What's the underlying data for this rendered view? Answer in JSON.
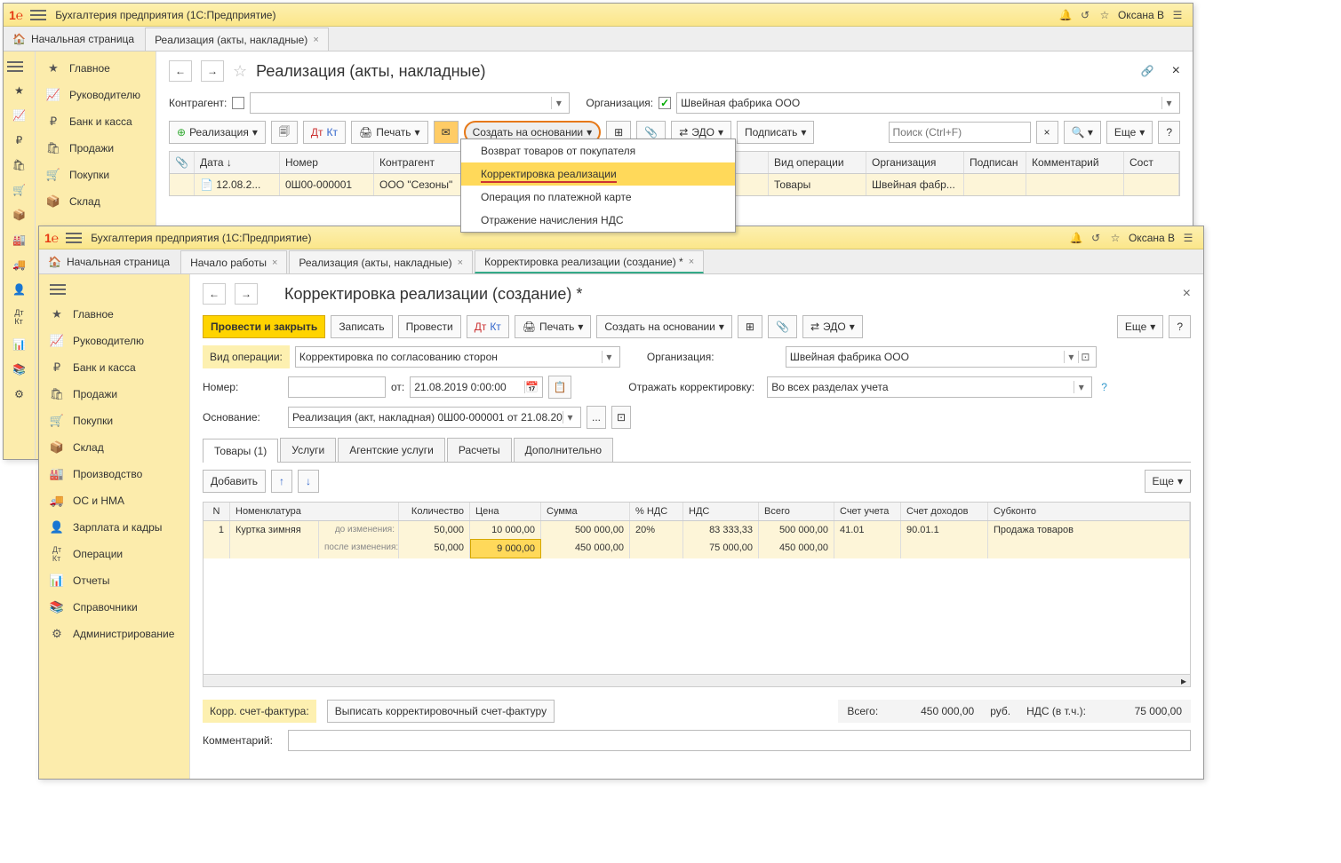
{
  "app": {
    "title": "Бухгалтерия предприятия  (1С:Предприятие)",
    "user": "Оксана В"
  },
  "win1": {
    "tabs": {
      "home": "Начальная страница",
      "t1": "Реализация (акты, накладные)"
    },
    "nav": [
      "Главное",
      "Руководителю",
      "Банк и касса",
      "Продажи",
      "Покупки",
      "Склад"
    ],
    "page": {
      "title": "Реализация (акты, накладные)",
      "contragent_lbl": "Контрагент:",
      "org_lbl": "Организация:",
      "org_val": "Швейная фабрика ООО"
    },
    "toolbar": {
      "real": "Реализация",
      "print": "Печать",
      "create": "Создать на основании",
      "edo": "ЭДО",
      "sign": "Подписать",
      "search_ph": "Поиск (Ctrl+F)",
      "more": "Еще"
    },
    "menu": {
      "i1": "Возврат товаров от покупателя",
      "i2": "Корректировка реализации",
      "i3": "Операция по платежной карте",
      "i4": "Отражение начисления НДС"
    },
    "grid": {
      "h": {
        "date": "Дата",
        "num": "Номер",
        "ka": "Контрагент",
        "op": "Вид операции",
        "org": "Организация",
        "sign": "Подписан",
        "comm": "Комментарий",
        "state": "Сост"
      },
      "r": {
        "date": "12.08.2...",
        "num": "0Ш00-000001",
        "ka": "ООО \"Сезоны\"",
        "op": "Товары",
        "org": "Швейная фабр..."
      }
    }
  },
  "win2": {
    "tabs": {
      "home": "Начальная страница",
      "t1": "Начало работы",
      "t2": "Реализация (акты, накладные)",
      "t3": "Корректировка реализации (создание) *"
    },
    "nav": [
      "Главное",
      "Руководителю",
      "Банк и касса",
      "Продажи",
      "Покупки",
      "Склад",
      "Производство",
      "ОС и НМА",
      "Зарплата и кадры",
      "Операции",
      "Отчеты",
      "Справочники",
      "Администрирование"
    ],
    "page": {
      "title": "Корректировка реализации (создание) *"
    },
    "tb": {
      "post_close": "Провести и закрыть",
      "save": "Записать",
      "post": "Провести",
      "print": "Печать",
      "create": "Создать на основании",
      "edo": "ЭДО",
      "more": "Еще"
    },
    "fields": {
      "optype_lbl": "Вид операции:",
      "optype_val": "Корректировка по согласованию сторон",
      "org_lbl": "Организация:",
      "org_val": "Швейная фабрика ООО",
      "num_lbl": "Номер:",
      "from_lbl": "от:",
      "date": "21.08.2019  0:00:00",
      "reflect_lbl": "Отражать корректировку:",
      "reflect_val": "Во всех разделах учета",
      "base_lbl": "Основание:",
      "base_val": "Реализация (акт, накладная) 0Ш00-000001 от 21.08.20"
    },
    "tabs2": {
      "t1": "Товары (1)",
      "t2": "Услуги",
      "t3": "Агентские услуги",
      "t4": "Расчеты",
      "t5": "Дополнительно"
    },
    "tbtb": {
      "add": "Добавить",
      "more": "Еще"
    },
    "th": {
      "n": "N",
      "nom": "Номенклатура",
      "qty": "Количество",
      "price": "Цена",
      "sum": "Сумма",
      "vatp": "% НДС",
      "vat": "НДС",
      "total": "Всего",
      "acc": "Счет учета",
      "inc": "Счет доходов",
      "sub": "Субконто"
    },
    "rowlbl": {
      "before": "до изменения:",
      "after": "после изменения:"
    },
    "row": {
      "n": "1",
      "nom": "Куртка зимняя",
      "qty1": "50,000",
      "price1": "10 000,00",
      "sum1": "500 000,00",
      "vatp": "20%",
      "vat1": "83 333,33",
      "total1": "500 000,00",
      "acc": "41.01",
      "inc": "90.01.1",
      "sub": "Продажа товаров",
      "qty2": "50,000",
      "price2": "9 000,00",
      "sum2": "450 000,00",
      "vat2": "75 000,00",
      "total2": "450 000,00"
    },
    "footer": {
      "sf_lbl": "Корр. счет-фактура:",
      "sf_btn": "Выписать корректировочный счет-фактуру",
      "total_lbl": "Всего:",
      "total": "450 000,00",
      "cur": "руб.",
      "vat_lbl": "НДС (в т.ч.):",
      "vat": "75 000,00",
      "comm_lbl": "Комментарий:"
    }
  }
}
